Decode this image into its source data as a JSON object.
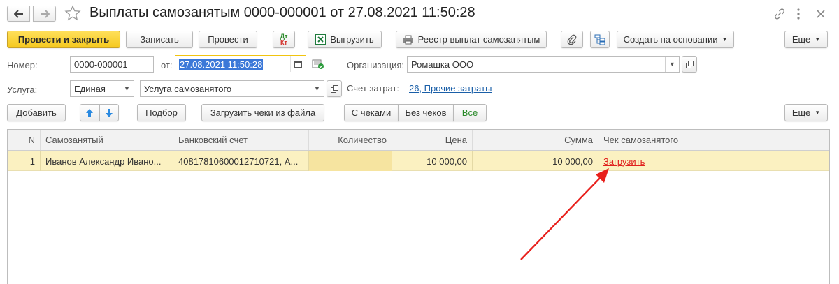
{
  "window": {
    "title": "Выплаты самозанятым 0000-000001 от 27.08.2021 11:50:28"
  },
  "toolbar": {
    "post_close": "Провести и закрыть",
    "write": "Записать",
    "post": "Провести",
    "dt_kt_top": "Дт",
    "dt_kt_bottom": "Кт",
    "export": "Выгрузить",
    "registry": "Реестр выплат самозанятым",
    "create_based": "Создать на основании",
    "more": "Еще"
  },
  "form": {
    "number_label": "Номер:",
    "number_value": "0000-000001",
    "date_label": "от:",
    "date_value": "27.08.2021 11:50:28",
    "org_label": "Организация:",
    "org_value": "Ромашка ООО",
    "service_label": "Услуга:",
    "service_type": "Единая",
    "service_value": "Услуга самозанятого",
    "cost_label": "Счет затрат:",
    "cost_value": "26, Прочие затраты"
  },
  "table_toolbar": {
    "add": "Добавить",
    "pick": "Подбор",
    "load_receipts": "Загрузить чеки из файла",
    "filter_with": "С чеками",
    "filter_without": "Без чеков",
    "filter_all": "Все",
    "more": "Еще"
  },
  "table": {
    "columns": [
      "N",
      "Самозанятый",
      "Банковский счет",
      "Количество",
      "Цена",
      "Сумма",
      "Чек самозанятого"
    ],
    "rows": [
      {
        "n": "1",
        "person": "Иванов Александр Ивано...",
        "account": "40817810600012710721, А...",
        "qty": "",
        "price": "10 000,00",
        "sum": "10 000,00",
        "receipt": "Загрузить"
      }
    ]
  },
  "colors": {
    "primary_button": "#f5c91e",
    "selected_row": "#fbf1c1",
    "link": "#1a5fa8",
    "receipt_link": "#e0201e",
    "arrow": "#e8201c",
    "filter_all_text": "#2a8a2a"
  }
}
